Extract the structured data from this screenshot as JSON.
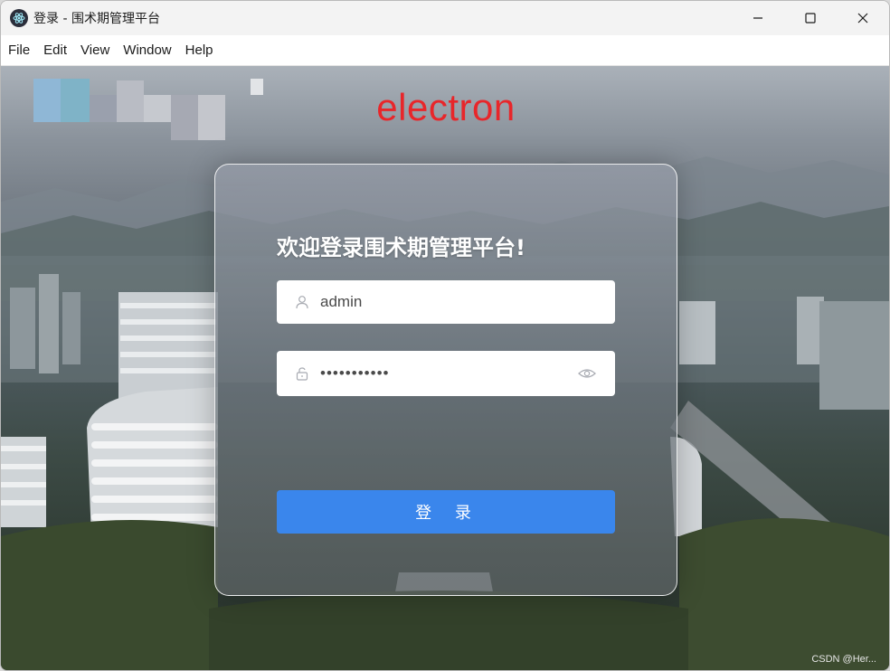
{
  "window": {
    "title": "登录 - 围术期管理平台",
    "controls": {
      "minimize": "minimize-icon",
      "maximize": "maximize-icon",
      "close": "close-icon"
    }
  },
  "menu": {
    "items": [
      "File",
      "Edit",
      "View",
      "Window",
      "Help"
    ]
  },
  "brand": {
    "text": "electron",
    "color": "#e8262a"
  },
  "login": {
    "welcome": "欢迎登录围术期管理平台!",
    "username": {
      "value": "admin",
      "icon": "user-icon"
    },
    "password": {
      "value": "•••••••••••",
      "icon": "lock-icon",
      "toggle_icon": "eye-icon"
    },
    "submit_label": "登 录",
    "submit_color": "#3a86ec"
  },
  "watermark": "CSDN @Her..."
}
